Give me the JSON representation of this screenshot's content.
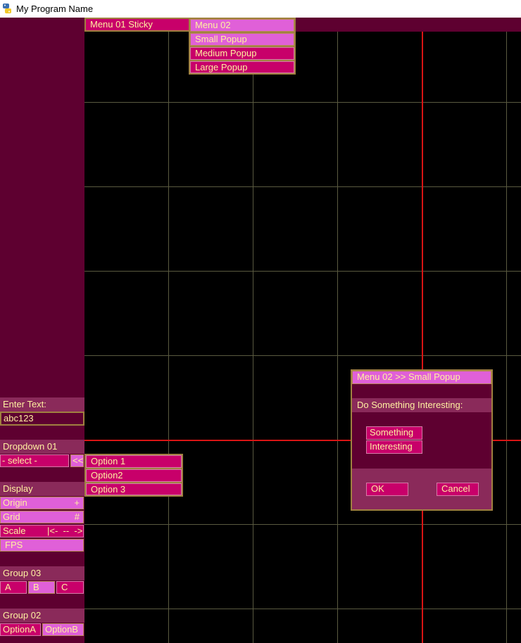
{
  "window": {
    "title": "My Program Name",
    "icon": "python-icon"
  },
  "menubar": {
    "menu1": "Menu 01 Sticky",
    "menu2": "Menu 02",
    "menu2_items": [
      "Small Popup",
      "Medium Popup",
      "Large Popup"
    ]
  },
  "sidebar": {
    "text_label": "Enter Text:",
    "text_value": "abc123",
    "dropdown_label": "Dropdown 01",
    "dropdown_value": "- select -",
    "dropdown_toggle": "<<",
    "dropdown_options": [
      "Option 1",
      "Option2",
      "Option 3"
    ],
    "display_label": "Display",
    "origin": "Origin",
    "origin_sym": "+",
    "grid": "Grid",
    "grid_sym": "#",
    "scale": "Scale",
    "scale_sym": "|<-  --  ->|",
    "fps": "FPS",
    "group3_label": "Group 03",
    "group3_buttons": [
      "A",
      "B",
      "C"
    ],
    "group2_label": "Group 02",
    "group2_buttons": [
      "OptionA",
      "OptionB"
    ]
  },
  "popup": {
    "title": "Menu 02 >> Small Popup",
    "heading": "Do Something Interesting:",
    "buttons": [
      "Something",
      "Interesting"
    ],
    "ok": "OK",
    "cancel": "Cancel"
  },
  "colors": {
    "panel": "#5e0030",
    "button": "#c8006a",
    "highlight": "#e060d8",
    "text": "#fff0a0",
    "axis": "#d81414",
    "grid": "#5a5a40"
  }
}
